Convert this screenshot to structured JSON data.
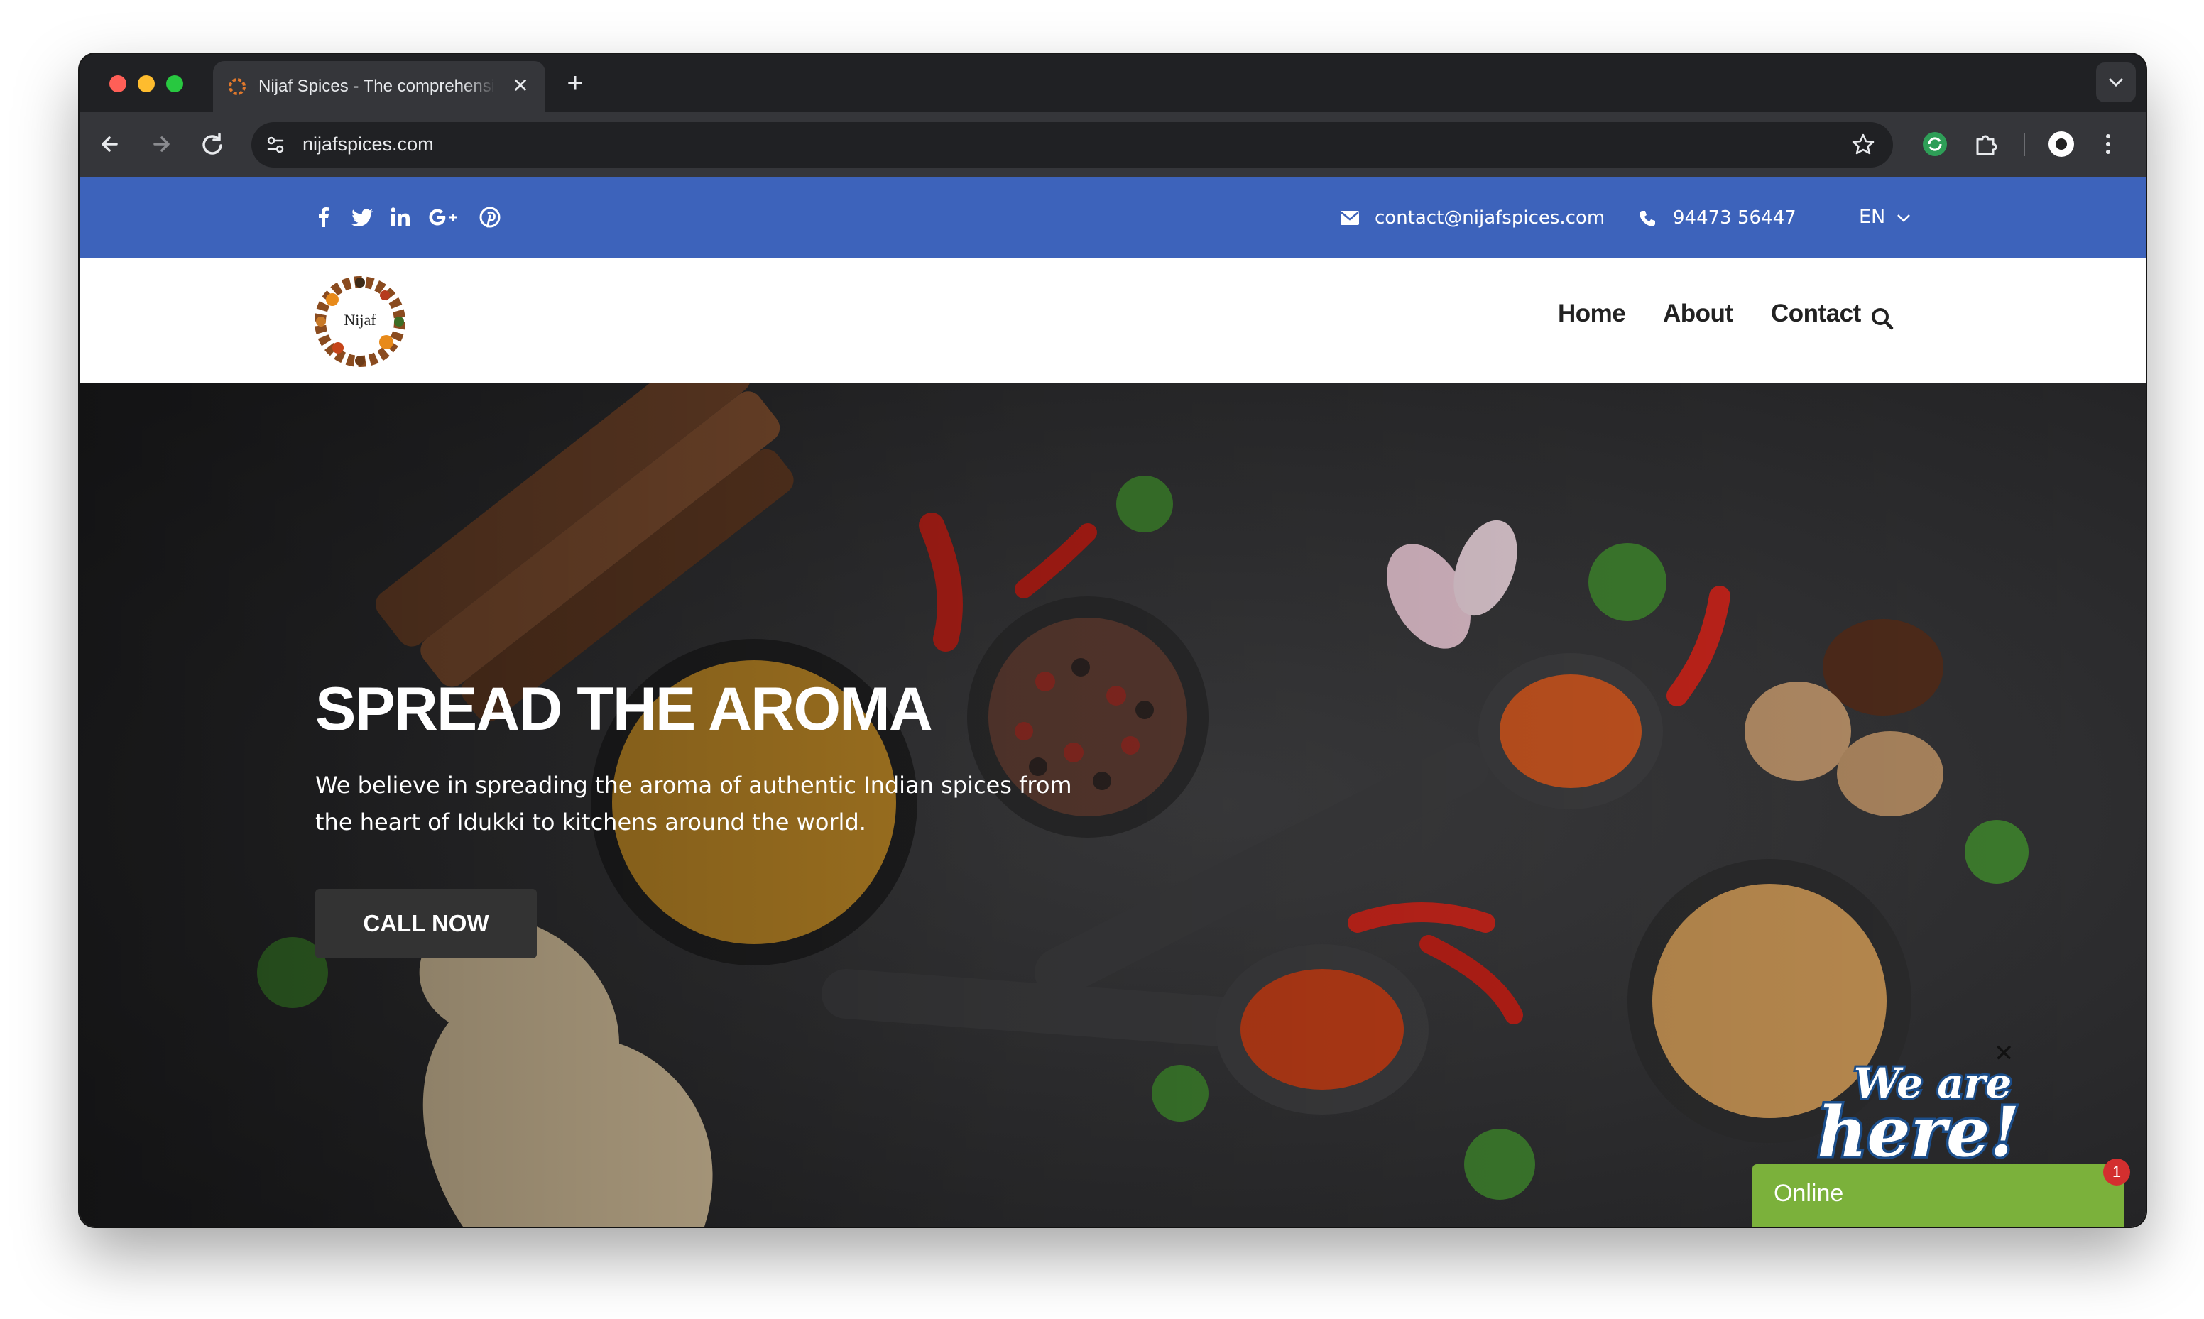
{
  "browser": {
    "tab_title": "Nijaf Spices - The comprehensive",
    "tab_close": "✕",
    "new_tab": "+",
    "url": "nijafspices.com"
  },
  "topbar": {
    "email": "contact@nijafspices.com",
    "phone": "94473 56447",
    "language": "EN",
    "social_icons": [
      "facebook-icon",
      "twitter-icon",
      "linkedin-icon",
      "google-plus-icon",
      "pinterest-icon"
    ]
  },
  "nav": {
    "logo_text": "Nijaf",
    "items": [
      "Home",
      "About",
      "Contact"
    ]
  },
  "hero": {
    "title": "SPREAD THE AROMA",
    "text": "We believe in spreading the aroma of authentic Indian spices from the heart of Idukki to kitchens around the world.",
    "cta": "CALL NOW"
  },
  "chat": {
    "bubble_line1": "We are",
    "bubble_line2": "here!",
    "close": "✕",
    "status": "Online",
    "badge": "1"
  },
  "colors": {
    "topbar": "#3d63bb",
    "chat_bar": "#7bb13b",
    "badge": "#d32f2f"
  }
}
